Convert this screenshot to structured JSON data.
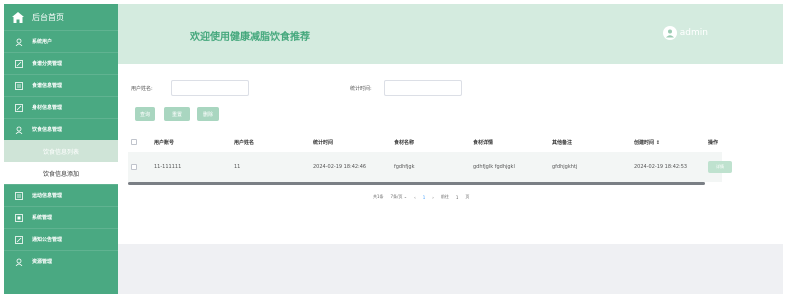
{
  "sidebar": {
    "home_label": "后台首页",
    "items": [
      {
        "label": "系统用户"
      },
      {
        "label": "食谱分类管理"
      },
      {
        "label": "食谱信息管理"
      },
      {
        "label": "身材信息管理"
      },
      {
        "label": "饮食信息管理"
      },
      {
        "label": "运动信息管理"
      },
      {
        "label": "系统管理"
      },
      {
        "label": "通知公告管理"
      },
      {
        "label": "资源管理"
      }
    ],
    "subs": [
      {
        "label": "饮食信息列表"
      },
      {
        "label": "饮食信息添加"
      }
    ]
  },
  "header": {
    "title": "欢迎使用健康减脂饮食推荐",
    "username": "admin"
  },
  "filters": {
    "username_label": "用户姓名:",
    "username_value": "",
    "time_label": "统计时间:",
    "time_value": ""
  },
  "buttons": {
    "query": "查询",
    "reset": "重置",
    "delete": "删除"
  },
  "table": {
    "columns": [
      "用户账号",
      "用户姓名",
      "统计时间",
      "食材名称",
      "食材详情",
      "其他备注",
      "创建时间 ↕",
      "操作"
    ],
    "rows": [
      {
        "account": "11-111111",
        "name": "11",
        "stat_time": "2024-02-19 18:42:46",
        "food_name": "fgdhfjgk",
        "food_detail": "gdhfjglk fgdhjgkl",
        "remark": "gfdhjgkhtj",
        "created": "2024-02-19 18:42:53",
        "action": "详情"
      }
    ]
  },
  "pagination": {
    "total": "共1条",
    "page_size": "7条/页",
    "dropdown": "⌄",
    "prev": "‹",
    "current": "1",
    "next": "›",
    "goto_label": "前往",
    "goto_value": "1",
    "page_suffix": "页"
  },
  "colors": {
    "sidebar": "#4aa982",
    "header": "#d4ebdf",
    "accent_text": "#45a87d"
  }
}
